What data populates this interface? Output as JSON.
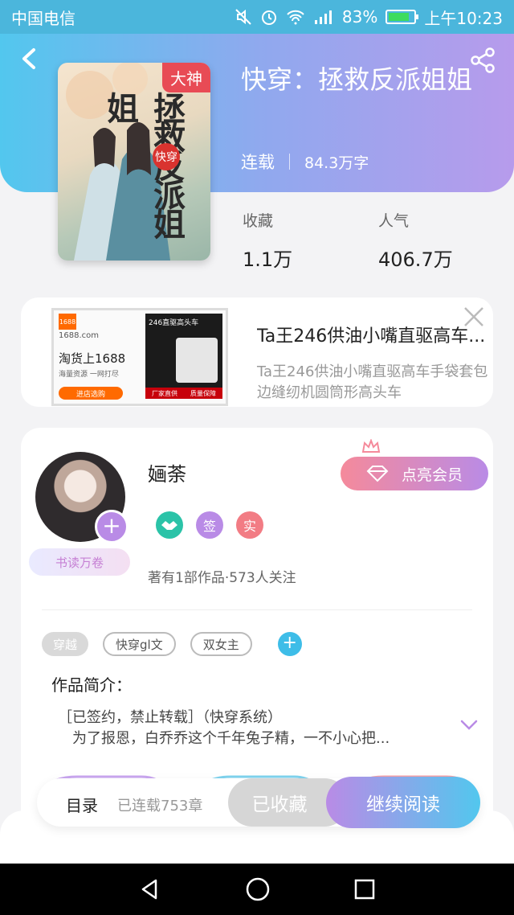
{
  "status_bar": {
    "carrier": "中国电信",
    "battery_percent": "83%",
    "time": "上午10:23",
    "battery_level": 0.83
  },
  "book": {
    "cover_badge": "大神",
    "title": "快穿：拯救反派姐姐",
    "status": "连载",
    "word_count": "84.3万字",
    "favorites_label": "收藏",
    "favorites_value": "1.1万",
    "popularity_label": "人气",
    "popularity_value": "406.7万"
  },
  "ad": {
    "title": "Ta王246供油小嘴直驱高车...",
    "description": "Ta王246供油小嘴直驱高车手袋套包边缝纫机圆筒形高头车",
    "image_text": {
      "logo": "1688",
      "site": "1688.com",
      "slogan": "淘货上1688",
      "sub": "海量资源 一网打尽",
      "cta": "进店选购",
      "product": "246直驱高头车",
      "foot_left": "厂家直供",
      "foot_right": "质量保障"
    }
  },
  "author": {
    "name": "婳荼",
    "reader_badge": "书读万卷",
    "vip_button": "点亮会员",
    "icon_sign": "签",
    "icon_real": "实",
    "works_info": "著有1部作品·573人关注"
  },
  "tags": [
    "穿越",
    "快穿gl文",
    "双女主"
  ],
  "intro": {
    "label": "作品简介：",
    "line1": "［已签约，禁止转载］（快穿系统）",
    "line2": "为了报恩，白乔乔这个千年兔子精，一不小心把..."
  },
  "actions": {
    "toc": "目录",
    "chapters": "已连载753章",
    "collected": "已收藏",
    "continue": "继续阅读"
  }
}
